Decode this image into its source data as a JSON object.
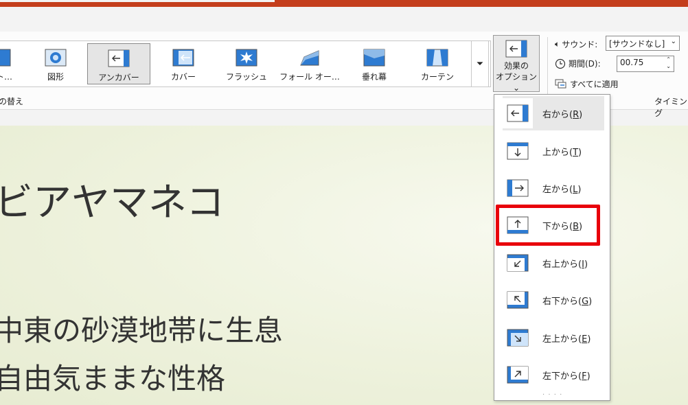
{
  "ribbon": {
    "transitions": [
      {
        "label": "スト…",
        "icon": "text-transition-icon"
      },
      {
        "label": "図形",
        "icon": "shape-transition-icon"
      },
      {
        "label": "アンカバー",
        "icon": "uncover-transition-icon",
        "selected": true
      },
      {
        "label": "カバー",
        "icon": "cover-transition-icon"
      },
      {
        "label": "フラッシュ",
        "icon": "flash-transition-icon"
      },
      {
        "label": "フォール オー…",
        "icon": "fall-over-transition-icon"
      },
      {
        "label": "垂れ幕",
        "icon": "drape-transition-icon"
      },
      {
        "label": "カーテン",
        "icon": "curtains-transition-icon"
      }
    ],
    "more_label": "⏷",
    "effect_options": {
      "line1": "効果の",
      "line2": "オプション",
      "chevron": "⌄"
    },
    "group_label": "の替え",
    "timing_group_label": "タイミング",
    "sound_label": "サウンド:",
    "sound_value": "[サウンドなし]",
    "duration_label": "期間(D):",
    "duration_value": "00.75",
    "apply_all_label": "すべてに適用"
  },
  "slide": {
    "title": "ビアヤマネコ",
    "bullets": [
      "中東の砂漠地帯に生息",
      "自由気ままな性格"
    ]
  },
  "effect_menu": [
    {
      "label": "右から",
      "key": "R",
      "icon": "from-right-icon",
      "hover": true
    },
    {
      "label": "上から",
      "key": "T",
      "icon": "from-top-icon"
    },
    {
      "label": "左から",
      "key": "L",
      "icon": "from-left-icon"
    },
    {
      "label": "下から",
      "key": "B",
      "icon": "from-bottom-icon",
      "highlighted": true
    },
    {
      "label": "右上から",
      "key": "I",
      "icon": "from-top-right-icon"
    },
    {
      "label": "右下から",
      "key": "G",
      "icon": "from-bottom-right-icon"
    },
    {
      "label": "左上から",
      "key": "E",
      "icon": "from-top-left-icon"
    },
    {
      "label": "左下から",
      "key": "F",
      "icon": "from-bottom-left-icon"
    }
  ],
  "colors": {
    "accent": "#c43e1c",
    "highlight": "#e8000b",
    "icon_blue": "#2e7bd1"
  }
}
